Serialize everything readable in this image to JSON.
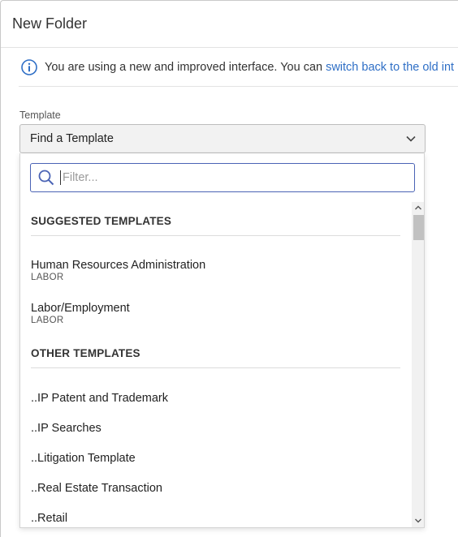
{
  "dialog": {
    "title": "New Folder"
  },
  "notice": {
    "text": "You are using a new and improved interface. You can",
    "link": "switch back to the old int"
  },
  "template_field": {
    "label": "Template",
    "selected": "Find a Template"
  },
  "dropdown": {
    "filter_placeholder": "Filter...",
    "sections": [
      {
        "header": "SUGGESTED TEMPLATES",
        "items": [
          {
            "name": "Human Resources Administration",
            "category": "LABOR"
          },
          {
            "name": "Labor/Employment",
            "category": "LABOR"
          }
        ]
      },
      {
        "header": "OTHER TEMPLATES",
        "items": [
          {
            "name": "..IP Patent and Trademark"
          },
          {
            "name": "..IP Searches"
          },
          {
            "name": "..Litigation Template"
          },
          {
            "name": "..Real Estate Transaction"
          },
          {
            "name": "..Retail"
          }
        ]
      }
    ]
  },
  "colors": {
    "link": "#2f6fc6",
    "focus_border": "#4a63b5"
  }
}
